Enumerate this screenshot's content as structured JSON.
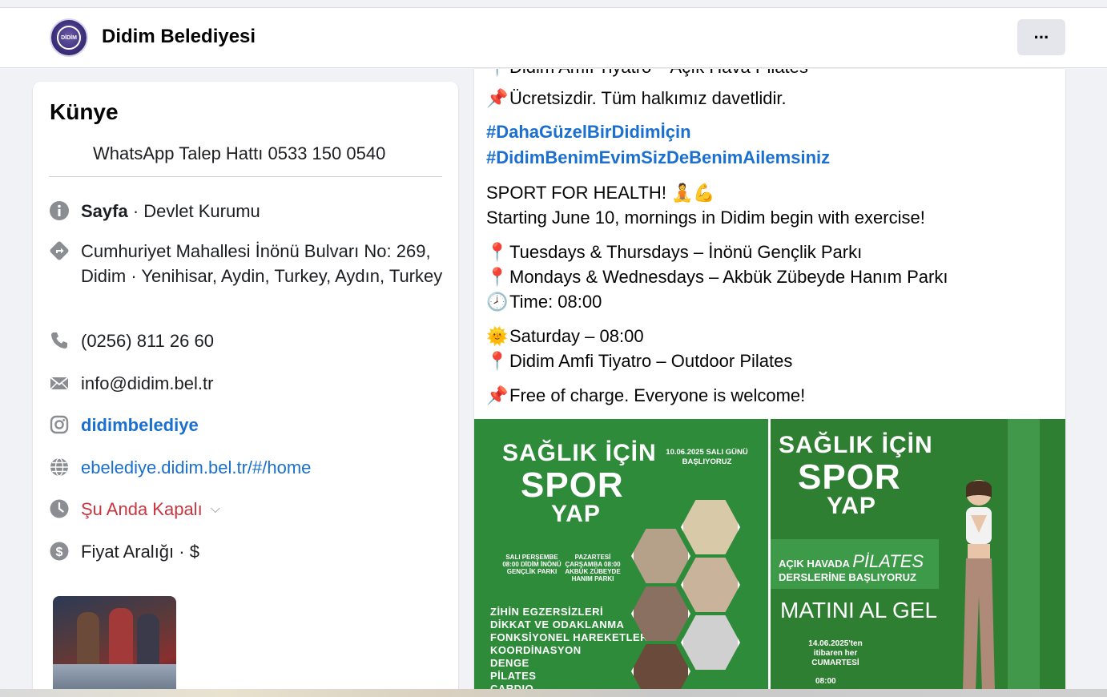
{
  "header": {
    "title": "Didim Belediyesi",
    "logo_text": "DİDİM",
    "more_label": "···"
  },
  "intro": {
    "heading": "Künye",
    "whatsapp": "WhatsApp Talep Hattı 0533 150 0540",
    "category_bold": "Sayfa",
    "category_rest": " · Devlet Kurumu",
    "address": "Cumhuriyet Mahallesi İnönü Bulvarı No: 269, Didim · Yenihisar, Aydin, Turkey, Aydın, Turkey",
    "phone": "(0256) 811 26 60",
    "email": "info@didim.bel.tr",
    "instagram": "didimbelediye",
    "website": "ebelediye.didim.bel.tr/#/home",
    "hours": "Şu Anda Kapalı",
    "price": "Fiyat Aralığı · $"
  },
  "post": {
    "cut_line": "Didim Amfi Tiyatro – Açık Hava Pilates",
    "free_tr": "Ücretsizdir. Tüm halkımız davetlidir.",
    "hashtag1": "#DahaGüzelBirDidimİçin",
    "hashtag2": "#DidimBenimEvimSizDeBenimAilemsiniz",
    "sport_title": "SPORT FOR HEALTH! 🧘💪",
    "starting": "Starting June 10, mornings in Didim begin with exercise!",
    "tue_thu": "Tuesdays & Thursdays – İnönü Gençlik Parkı",
    "mon_wed": "Mondays & Wednesdays – Akbük Zübeyde Hanım Parkı",
    "time": "Time: 08:00",
    "saturday": "Saturday – 08:00",
    "amfi": "Didim Amfi Tiyatro – Outdoor Pilates",
    "free_en": "Free of charge. Everyone is welcome!"
  },
  "poster_a": {
    "line1": "SAĞLIK İÇİN",
    "line2": "SPOR",
    "line3": "YAP",
    "date": "10.06.2025 SALI GÜNÜ BAŞLIYORUZ",
    "meta1": "SALI PERŞEMBE 08:00 DİDİM İNÖNÜ GENÇLİK PARKI",
    "meta2": "PAZARTESİ ÇARŞAMBA 08:00 AKBÜK ZÜBEYDE HANIM PARKI",
    "items": [
      "ZİHİN EGZERSİZLERİ",
      "DİKKAT VE ODAKLANMA",
      "FONKSİYONEL HAREKETLER",
      "KOORDİNASYON",
      "DENGE",
      "PİLATES",
      "CARDIO"
    ]
  },
  "poster_b": {
    "line1": "SAĞLIK İÇİN",
    "line2": "SPOR",
    "line3": "YAP",
    "sub1a": "AÇIK HAVADA",
    "sub1b": "PİLATES",
    "sub2": "DERSLERİNE BAŞLIYORUZ",
    "mat": "MATINI AL GEL",
    "date": "14.06.2025'ten itibaren her CUMARTESİ",
    "time": "08:00"
  },
  "colors": {
    "link": "#1a6fcf",
    "closed": "#c9353f",
    "poster_green": "#2e8b3a"
  }
}
